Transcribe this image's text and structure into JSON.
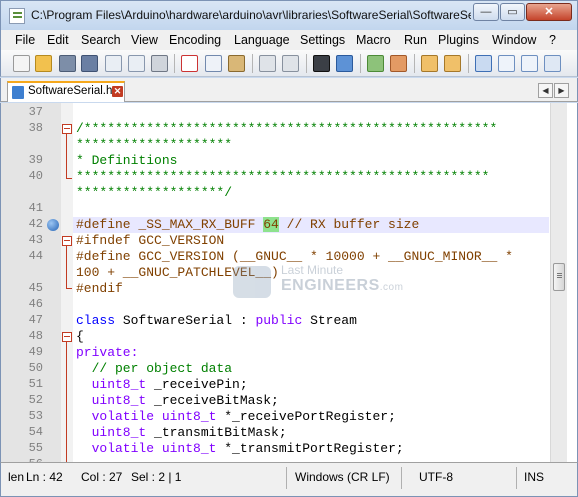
{
  "window": {
    "title": "C:\\Program Files\\Arduino\\hardware\\arduino\\avr\\libraries\\SoftwareSerial\\SoftwareSerial.h - Notepad++"
  },
  "window_controls": {
    "minimize": "—",
    "maximize": "▭",
    "close": "✕"
  },
  "menu": [
    "File",
    "Edit",
    "Search",
    "View",
    "Encoding",
    "Language",
    "Settings",
    "Macro",
    "Run",
    "Plugins",
    "Window",
    "?"
  ],
  "toolbar_icons": [
    "new-file-icon",
    "open-file-icon",
    "save-icon",
    "save-all-icon",
    "close-icon",
    "close-all-icon",
    "print-icon",
    "cut-icon",
    "copy-icon",
    "paste-icon",
    "undo-icon",
    "redo-icon",
    "find-icon",
    "replace-icon",
    "zoom-in-icon",
    "zoom-out-icon",
    "sync-vertical-icon",
    "sync-horizontal-icon",
    "word-wrap-icon",
    "show-all-chars-icon",
    "indent-guide-icon",
    "doc-map-icon"
  ],
  "tab": {
    "label": "SoftwareSerial.h",
    "close": "✕",
    "arrow_left": "◀",
    "arrow_right": "▶"
  },
  "editor": {
    "lines": [
      {
        "num": "37",
        "tokens": []
      },
      {
        "num": "38",
        "tokens": [
          {
            "c": "c-comment",
            "t": "/*****************************************************"
          }
        ]
      },
      {
        "num": "",
        "tokens": [
          {
            "c": "c-comment",
            "t": "********************"
          }
        ]
      },
      {
        "num": "39",
        "tokens": [
          {
            "c": "c-comment",
            "t": "* Definitions"
          }
        ]
      },
      {
        "num": "40",
        "tokens": [
          {
            "c": "c-comment",
            "t": "*****************************************************"
          }
        ]
      },
      {
        "num": "",
        "tokens": [
          {
            "c": "c-comment",
            "t": "*******************/"
          }
        ]
      },
      {
        "num": "41",
        "tokens": []
      },
      {
        "num": "42",
        "tokens": [
          {
            "c": "c-pre",
            "t": "#define _SS_MAX_RX_BUFF "
          },
          {
            "c": "c-pre c-hl",
            "t": "64"
          },
          {
            "c": "c-pre",
            "t": " // RX buffer size"
          }
        ]
      },
      {
        "num": "43",
        "tokens": [
          {
            "c": "c-pre",
            "t": "#ifndef GCC_VERSION"
          }
        ]
      },
      {
        "num": "44",
        "tokens": [
          {
            "c": "c-pre",
            "t": "#define GCC_VERSION (__GNUC__ * 10000 + __GNUC_MINOR__ *"
          }
        ]
      },
      {
        "num": "",
        "tokens": [
          {
            "c": "c-pre",
            "t": "100 + __GNUC_PATCHLEVEL__)"
          }
        ]
      },
      {
        "num": "45",
        "tokens": [
          {
            "c": "c-pre",
            "t": "#endif"
          }
        ]
      },
      {
        "num": "46",
        "tokens": []
      },
      {
        "num": "47",
        "tokens": [
          {
            "c": "c-kw2",
            "t": "class"
          },
          {
            "c": "c-normal",
            "t": " SoftwareSerial : "
          },
          {
            "c": "c-kw",
            "t": "public"
          },
          {
            "c": "c-normal",
            "t": " Stream"
          }
        ]
      },
      {
        "num": "48",
        "tokens": [
          {
            "c": "c-normal",
            "t": "{"
          }
        ]
      },
      {
        "num": "49",
        "tokens": [
          {
            "c": "c-kw",
            "t": "private:"
          }
        ]
      },
      {
        "num": "50",
        "tokens": [
          {
            "c": "c-comment",
            "t": "  // per object data"
          }
        ]
      },
      {
        "num": "51",
        "tokens": [
          {
            "c": "c-kw",
            "t": "  uint8_t"
          },
          {
            "c": "c-normal",
            "t": " _receivePin;"
          }
        ]
      },
      {
        "num": "52",
        "tokens": [
          {
            "c": "c-kw",
            "t": "  uint8_t"
          },
          {
            "c": "c-normal",
            "t": " _receiveBitMask;"
          }
        ]
      },
      {
        "num": "53",
        "tokens": [
          {
            "c": "c-kw",
            "t": "  volatile uint8_t"
          },
          {
            "c": "c-normal",
            "t": " *_receivePortRegister;"
          }
        ]
      },
      {
        "num": "54",
        "tokens": [
          {
            "c": "c-kw",
            "t": "  uint8_t"
          },
          {
            "c": "c-normal",
            "t": " _transmitBitMask;"
          }
        ]
      },
      {
        "num": "55",
        "tokens": [
          {
            "c": "c-kw",
            "t": "  volatile uint8_t"
          },
          {
            "c": "c-normal",
            "t": " *_transmitPortRegister;"
          }
        ]
      },
      {
        "num": "56",
        "tokens": []
      }
    ]
  },
  "watermark": {
    "line1": "Last Minute",
    "line2": "ENGINEERS",
    "suffix": ".com"
  },
  "status": {
    "lang": "len",
    "ln": "Ln : 42",
    "col": "Col : 27",
    "sel": "Sel : 2 | 1",
    "eol": "Windows (CR LF)",
    "encoding": "UTF-8",
    "mode": "INS"
  }
}
